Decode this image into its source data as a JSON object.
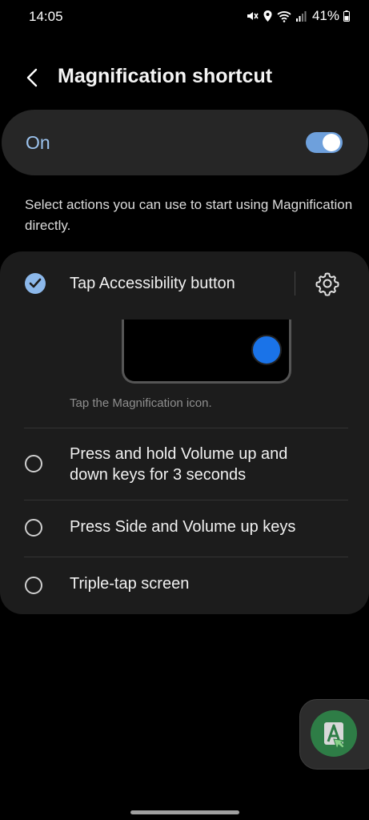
{
  "status_bar": {
    "time": "14:05",
    "battery": "41%",
    "icons": [
      "mute-icon",
      "location-icon",
      "wifi-icon",
      "signal-icon",
      "battery-icon"
    ]
  },
  "header": {
    "title": "Magnification shortcut",
    "back_icon": "chevron-left-icon"
  },
  "toggle": {
    "label": "On",
    "state": true,
    "accent_color": "#6ea0dc"
  },
  "description": "Select actions you can use to start using Magnification directly.",
  "options": [
    {
      "label": "Tap Accessibility button",
      "selected": true,
      "caption": "Tap the Magnification icon."
    },
    {
      "label_line1": "Press and hold Volume up and",
      "label_line2": "down keys for 3 seconds",
      "selected": false
    },
    {
      "label": "Press Side and Volume up keys",
      "selected": false
    },
    {
      "label": "Triple-tap screen",
      "selected": false
    }
  ],
  "floating_button": {
    "icon": "accessibility-icon"
  }
}
